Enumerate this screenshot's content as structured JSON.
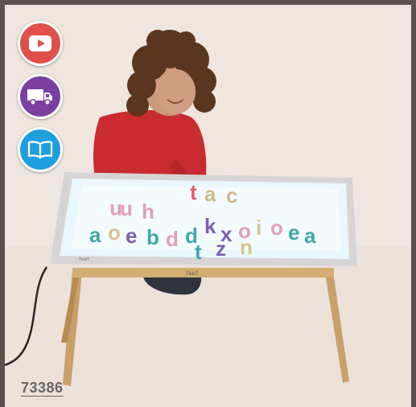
{
  "product": {
    "code": "73386",
    "table_brand": "TickiT"
  },
  "badges": [
    {
      "name": "youtube-icon",
      "color": "#e0504a"
    },
    {
      "name": "delivery-truck-icon",
      "color": "#7a3fa0"
    },
    {
      "name": "book-icon",
      "color": "#1f9fdc"
    }
  ],
  "photo": {
    "letters": [
      "c",
      "a",
      "t",
      "n",
      "u",
      "h",
      "o",
      "a",
      "b",
      "d",
      "e",
      "k",
      "z",
      "x",
      "t",
      "i",
      "o"
    ]
  }
}
